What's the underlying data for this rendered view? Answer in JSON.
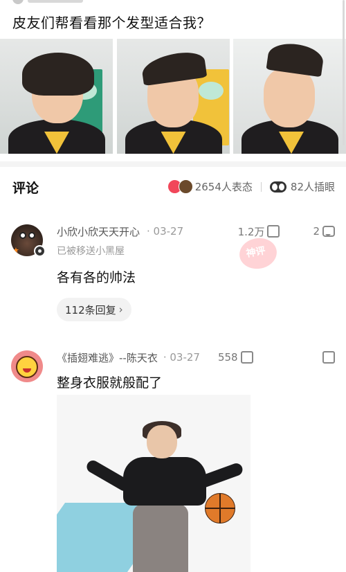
{
  "post": {
    "title": "皮友们帮看看那个发型适合我？"
  },
  "photos": [
    {
      "label": "hairstyle-1"
    },
    {
      "label": "hairstyle-2"
    },
    {
      "label": "hairstyle-3"
    }
  ],
  "comments_section": {
    "header": "评论",
    "reactions_text": "2654人表态",
    "eyeroll_text": "82人插眼"
  },
  "comments": [
    {
      "user": "小欣小欣天天开心",
      "date": "· 03-27",
      "likes": "1.2万",
      "reply_count": "2",
      "note": "已被移送小黑屋",
      "text": "各有各的帅法",
      "replies": "112条回复",
      "replies_chevron": "›",
      "stamp": "神评"
    },
    {
      "user": "《插翅难逃》--陈天衣",
      "date": "· 03-27",
      "likes": "558",
      "text": "整身衣服就般配了"
    }
  ],
  "icons": {
    "thumb_up": "thumb-up-icon",
    "comment": "comment-bubble-icon",
    "thumb_down": "thumb-down-icon",
    "eyes": "eyes-icon",
    "reaction_love": "love-reaction-icon",
    "reaction_poop": "poop-reaction-icon"
  },
  "colors": {
    "accent": "#f1475a",
    "text_primary": "#111111",
    "text_secondary": "#999999"
  }
}
